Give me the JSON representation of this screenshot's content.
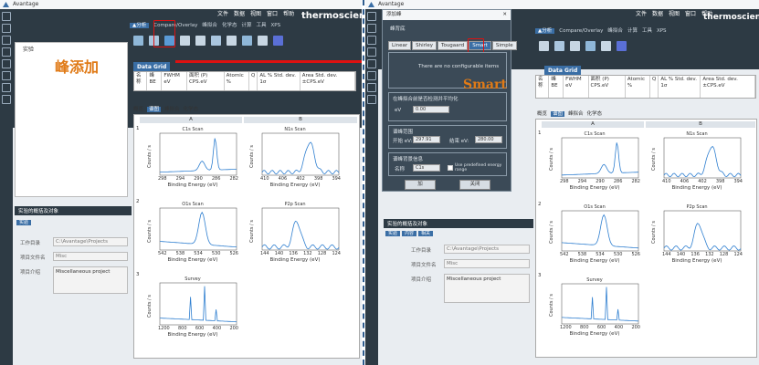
{
  "app_title": "Avantage",
  "menu": [
    "文件",
    "数据",
    "视图",
    "窗口",
    "帮助"
  ],
  "brand": "thermoscientific",
  "ribbon_tabs": [
    "▲分析",
    "Compare/Overlay",
    "峰拟合",
    "化学态",
    "元素分析",
    "计算",
    "工具",
    "Compare",
    "XPS"
  ],
  "tree_item": "实验",
  "callout_left": "峰添加",
  "callout_right": "Smart",
  "grid_title": "Data Grid",
  "grid_cols": [
    "名称",
    "峰BE",
    "FWHM eV",
    "面积 (P) CPS.eV",
    "Atomic %",
    "Q",
    "AL % Std. dev. 1σ",
    "Area Std. dev. ±CPS.eV"
  ],
  "subtabs": [
    "概览",
    "谱图",
    "峰拟合",
    "化学态"
  ],
  "columns": [
    "A",
    "B"
  ],
  "rows": [
    "1",
    "2",
    "3"
  ],
  "plots": [
    {
      "title": "C1s Scan",
      "xticks": [
        "298",
        "294",
        "290",
        "286",
        "282"
      ],
      "ylabel": "Counts / s",
      "xlabel": "Binding Energy (eV)"
    },
    {
      "title": "N1s Scan",
      "xticks": [
        "410",
        "406",
        "402",
        "398",
        "394"
      ],
      "ylabel": "Counts / s",
      "xlabel": "Binding Energy (eV)"
    },
    {
      "title": "O1s Scan",
      "xticks": [
        "542",
        "538",
        "534",
        "530",
        "526"
      ],
      "ylabel": "Counts / s",
      "xlabel": "Binding Energy (eV)"
    },
    {
      "title": "P2p Scan",
      "xticks": [
        "144",
        "140",
        "136",
        "132",
        "128",
        "124"
      ],
      "ylabel": "Counts / s",
      "xlabel": "Binding Energy (eV)"
    },
    {
      "title": "Survey",
      "xticks": [
        "1200",
        "800",
        "600",
        "400",
        "200"
      ],
      "ylabel": "Counts / s",
      "xlabel": "Binding Energy (eV)"
    }
  ],
  "project": {
    "header": "实验的概括及对象",
    "tabs": [
      "实验",
      "内容",
      "相关"
    ],
    "fields": [
      {
        "label": "工作目录",
        "value": "C:\\Avantage\\Projects"
      },
      {
        "label": "项目文件名",
        "value": "Misc"
      },
      {
        "label": "项目介绍",
        "value": "Miscellaneous project"
      }
    ]
  },
  "dialog": {
    "title": "添加峰",
    "type_label": "峰背底",
    "bg_tabs": [
      "Linear",
      "Shirley",
      "Tougaard",
      "Smart",
      "Simple"
    ],
    "no_items": "There are no configurable items",
    "section1": "在峰拟合前是否检测并平均化",
    "ev_label": "eV",
    "ev_value": "0.00",
    "section2": "谱峰范围",
    "start_label": "开始 eV:",
    "start_value": "297.91",
    "end_label": "结束 eV:",
    "end_value": "280.00",
    "section3": "谱峰背景信息",
    "name_label": "名称",
    "name_value": "C1s",
    "check_label": "Use predefined energy range",
    "ok": "加",
    "close": "关闭"
  }
}
